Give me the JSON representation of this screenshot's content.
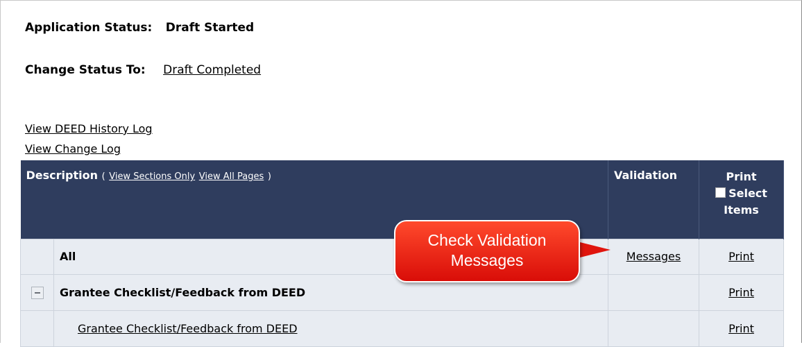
{
  "status": {
    "application_label": "Application Status:",
    "application_value": "Draft Started",
    "change_label": "Change Status To:",
    "change_link": "Draft Completed"
  },
  "links": {
    "history_log": "View DEED History Log",
    "change_log": "View Change Log"
  },
  "table": {
    "header": {
      "description": "Description",
      "open_paren": "(",
      "sections_only": "View Sections Only",
      "all_pages": "View All Pages",
      "close_paren": ")",
      "validation": "Validation",
      "print": "Print",
      "select": "Select",
      "items": "Items"
    },
    "rows": [
      {
        "description": "All",
        "validation": "Messages",
        "print": "Print"
      },
      {
        "description": "Grantee Checklist/Feedback from DEED",
        "validation": "",
        "print": "Print"
      },
      {
        "description": "Grantee Checklist/Feedback from DEED",
        "validation": "",
        "print": "Print"
      }
    ]
  },
  "callout": {
    "line1": "Check Validation",
    "line2": "Messages"
  },
  "colors": {
    "header_bg": "#2f3d5e",
    "row_bg": "#e8ecf2",
    "callout_red": "#e0150e"
  }
}
